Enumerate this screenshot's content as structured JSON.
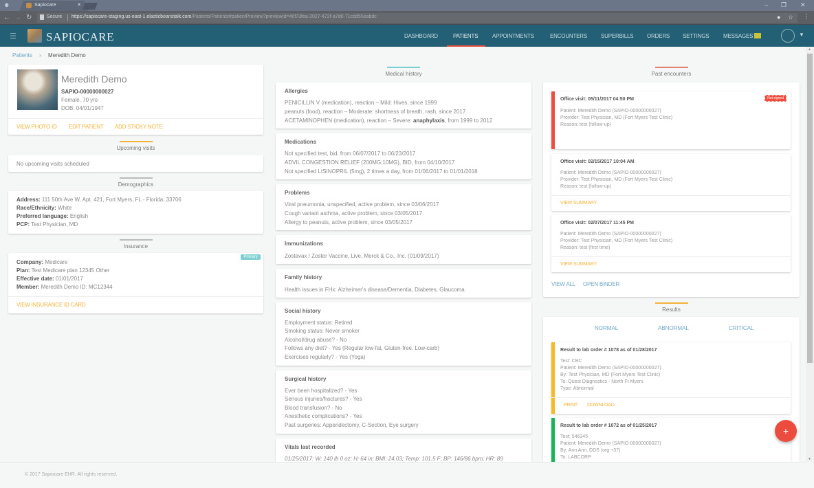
{
  "browser": {
    "tab_title": "Sapiocare",
    "secure_label": "Secure",
    "url_host": "https://sapiocare-staging.us-east-1.elasticbeanstalk.com",
    "url_path": "/Patients/Patients#patientPreview?previewId=40f73fea-2027-472f-a7d0-71cdd55eabdc"
  },
  "app": {
    "logo_text": "SAPIOCARE",
    "nav": [
      "DASHBOARD",
      "PATIENTS",
      "APPOINTMENTS",
      "ENCOUNTERS",
      "SUPERBILLS",
      "ORDERS",
      "SETTINGS",
      "MESSAGES"
    ],
    "active_nav": "PATIENTS",
    "accent_color": "#235f75",
    "link_color": "#f4b43b"
  },
  "breadcrumb": {
    "parent": "Patients",
    "current": "Meredith Demo"
  },
  "patient": {
    "name": "Meredith Demo",
    "id": "SAPIO-00000000027",
    "gender_age": "Female, 70 y/o",
    "dob": "DOB: 04/01/1947",
    "actions": [
      "VIEW PHOTO ID",
      "EDIT PATIENT",
      "ADD STICKY NOTE"
    ]
  },
  "upcoming": {
    "title": "Upcoming visits",
    "empty": "No upcoming visits scheduled"
  },
  "demographics": {
    "title": "Demographics",
    "rows": [
      {
        "label": "Address:",
        "value": "111 50th Ave W, Apt. 421, Fort Myers, FL - Florida, 33706"
      },
      {
        "label": "Race/Ethnicity:",
        "value": "White"
      },
      {
        "label": "Preferred language:",
        "value": "English"
      },
      {
        "label": "PCP:",
        "value": "Test Physician, MD"
      }
    ]
  },
  "insurance": {
    "title": "Insurance",
    "badge": "Primary",
    "rows": [
      {
        "label": "Company:",
        "value": "Medicare"
      },
      {
        "label": "Plan:",
        "value": "Test Medicare plan 12345 Other"
      },
      {
        "label": "Effective date:",
        "value": "01/01/2017"
      },
      {
        "label": "Member:",
        "value": "Meredith Demo ID: MC12344"
      }
    ],
    "action": "VIEW INSURANCE ID CARD"
  },
  "medical_history": {
    "title": "Medical history",
    "allergies": {
      "title": "Allergies",
      "lines": [
        "PENICILLIN V (medication), reaction – Mild: Hives, since 1999",
        "peanuts (food), reaction – Moderate: shortness of breath, rash, since 2017"
      ],
      "severe_prefix": "ACETAMINOPHEN (medication), reaction – Severe: ",
      "severe_bold": "anaphylaxis",
      "severe_suffix": ", from 1999 to 2012"
    },
    "medications": {
      "title": "Medications",
      "lines": [
        "Not specified test, bid, from 06/07/2017 to 06/23/2017",
        "ADVIL CONGESTION RELIEF (200MG;10MG), BID, from 04/10/2017",
        "Not specified LISINOPRIL (5mg), 2 times a day, from 01/06/2017 to 01/01/2018"
      ]
    },
    "problems": {
      "title": "Problems",
      "lines": [
        "Viral pneumonia, unspecified, active problem, since 03/06/2017",
        "Cough variant asthma, active problem, since 03/05/2017",
        "Allergy to peanuts, active problem, since 03/05/2017"
      ]
    },
    "immunizations": {
      "title": "Immunizations",
      "lines": [
        "Zostavax / Zoster Vaccine, Live, Merck & Co., Inc. (01/09/2017)"
      ]
    },
    "family": {
      "title": "Family history",
      "lines": [
        "Health issues in FHx: Alzheimer's disease/Dementia, Diabetes, Glaucoma"
      ]
    },
    "social": {
      "title": "Social history",
      "lines": [
        "Employment status: Retired",
        "Smoking status: Never smoker",
        "Alcohol/drug abuse? - No",
        "Follows any diet? - Yes (Regular low-fat, Gluten-free, Low-carb)",
        "Exercises regularly? - Yes (Yoga)"
      ]
    },
    "surgical": {
      "title": "Surgical history",
      "lines": [
        "Ever been hospitalized? - Yes",
        "Serious injuries/fractures? - Yes",
        "Blood transfusion? - No",
        "Anesthetic complications? - Yes",
        "Past surgeries: Appendectomy, C-Section, Eye surgery"
      ]
    },
    "vitals": {
      "title": "Vitals last recorded",
      "lines": [
        "01/25/2017: W: 140 lb 0 oz; H: 64 in; BMI: 24.03; Temp: 101.5 F; BP: 146/86 bpm; HR: 89"
      ]
    }
  },
  "encounters": {
    "title": "Past encounters",
    "items": [
      {
        "title": "Office visit: 05/11/2017 04:50 PM",
        "patient": "Patient: Meredith Demo (SAPIO-00000000027)",
        "provider": "Provider: Test Physician, MD (Fort Myers Test Clinic)",
        "reason": "Reason: test (follow-up)",
        "badge": "Not signed",
        "action": ""
      },
      {
        "title": "Office visit: 02/15/2017 10:04 AM",
        "patient": "Patient: Meredith Demo (SAPIO-00000000027)",
        "provider": "Provider: Test Physician, MD (Fort Myers Test Clinic)",
        "reason": "Reason: test (follow-up)",
        "badge": "",
        "action": "VIEW SUMMARY"
      },
      {
        "title": "Office visit: 02/07/2017 11:45 PM",
        "patient": "Patient: Meredith Demo (SAPIO-00000000027)",
        "provider": "Provider: Test Physician, MD (Fort Myers Test Clinic)",
        "reason": "Reason: test (first time)",
        "badge": "",
        "action": "VIEW SUMMARY"
      }
    ],
    "view_all": "VIEW ALL",
    "open_binder": "OPEN BINDER"
  },
  "results": {
    "title": "Results",
    "tabs": [
      "NORMAL",
      "ABNORMAL",
      "CRITICAL"
    ],
    "items": [
      {
        "title": "Result to lab order # 1078 as of 01/28/2017",
        "lines": [
          "Test: CBC",
          "Patient: Meredith Demo (SAPIO-00000000027)",
          "By: Test Physician, MD (Fort Myers Test Clinic)",
          "To: Quest Diagnostics - North Ft Myers",
          "Type: Abnormal"
        ],
        "actions": [
          "PRINT",
          "DOWNLOAD"
        ],
        "color": "#f7b924"
      },
      {
        "title": "Result to lab order # 1072 as of 01/25/2017",
        "lines": [
          "Test: 546345",
          "Patient: Meredith Demo (SAPIO-00000000027)",
          "By: Ann Ann, DDS (org +37)",
          "To: LABCORP"
        ],
        "actions": [],
        "color": "#1db35a"
      }
    ]
  },
  "fab_label": "+",
  "footer": "© 2017 Sapiocare EHR. All rights reserved."
}
